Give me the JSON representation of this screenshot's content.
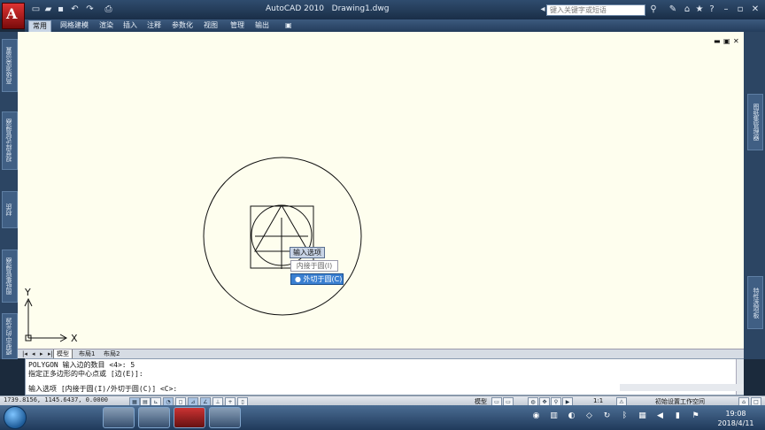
{
  "title": {
    "app": "AutoCAD 2010",
    "file": "Drawing1.dwg",
    "search_placeholder": "键入关键字或短语"
  },
  "ribbon": {
    "tabs": [
      {
        "label": "常用",
        "active": true
      },
      {
        "label": "网格建模"
      },
      {
        "label": "渲染"
      },
      {
        "label": "插入"
      },
      {
        "label": "注释"
      },
      {
        "label": "参数化"
      },
      {
        "label": "视图"
      },
      {
        "label": "管理"
      },
      {
        "label": "输出"
      }
    ]
  },
  "left_panels": [
    "高级渲染设置",
    "视觉样式管理器",
    "材质",
    "图纸集管理器",
    "模型中的光源"
  ],
  "right_panels": [
    "图纸集管理器",
    "特性选项板"
  ],
  "ucs": {
    "x": "X",
    "y": "Y"
  },
  "dynamic_menu": {
    "header": "输入选项",
    "options": [
      {
        "label": "内接于圆(I)",
        "selected": false
      },
      {
        "label": "外切于圆(C)",
        "selected": true,
        "bullet": "●"
      }
    ]
  },
  "layout_tabs": [
    "模型",
    "布局1",
    "布局2"
  ],
  "command": {
    "lines": [
      "POLYGON 输入边的数目 <4>: 5",
      "指定正多边形的中心点或 [边(E)]:"
    ],
    "prompt": "输入选项 [内接于圆(I)/外切于圆(C)] <C>:"
  },
  "status": {
    "coords": "1739.8156, 1145.6437, 0.0000",
    "model": "模型",
    "scale": "1:1",
    "workspace": "初始设置工作空间"
  },
  "taskbar": {
    "time": "19:08",
    "date": "2018/4/11"
  },
  "colors": {
    "canvas_bg": "#fefeee",
    "selected_option": "#3a7fd1",
    "title_bg": "#1a2e47"
  }
}
